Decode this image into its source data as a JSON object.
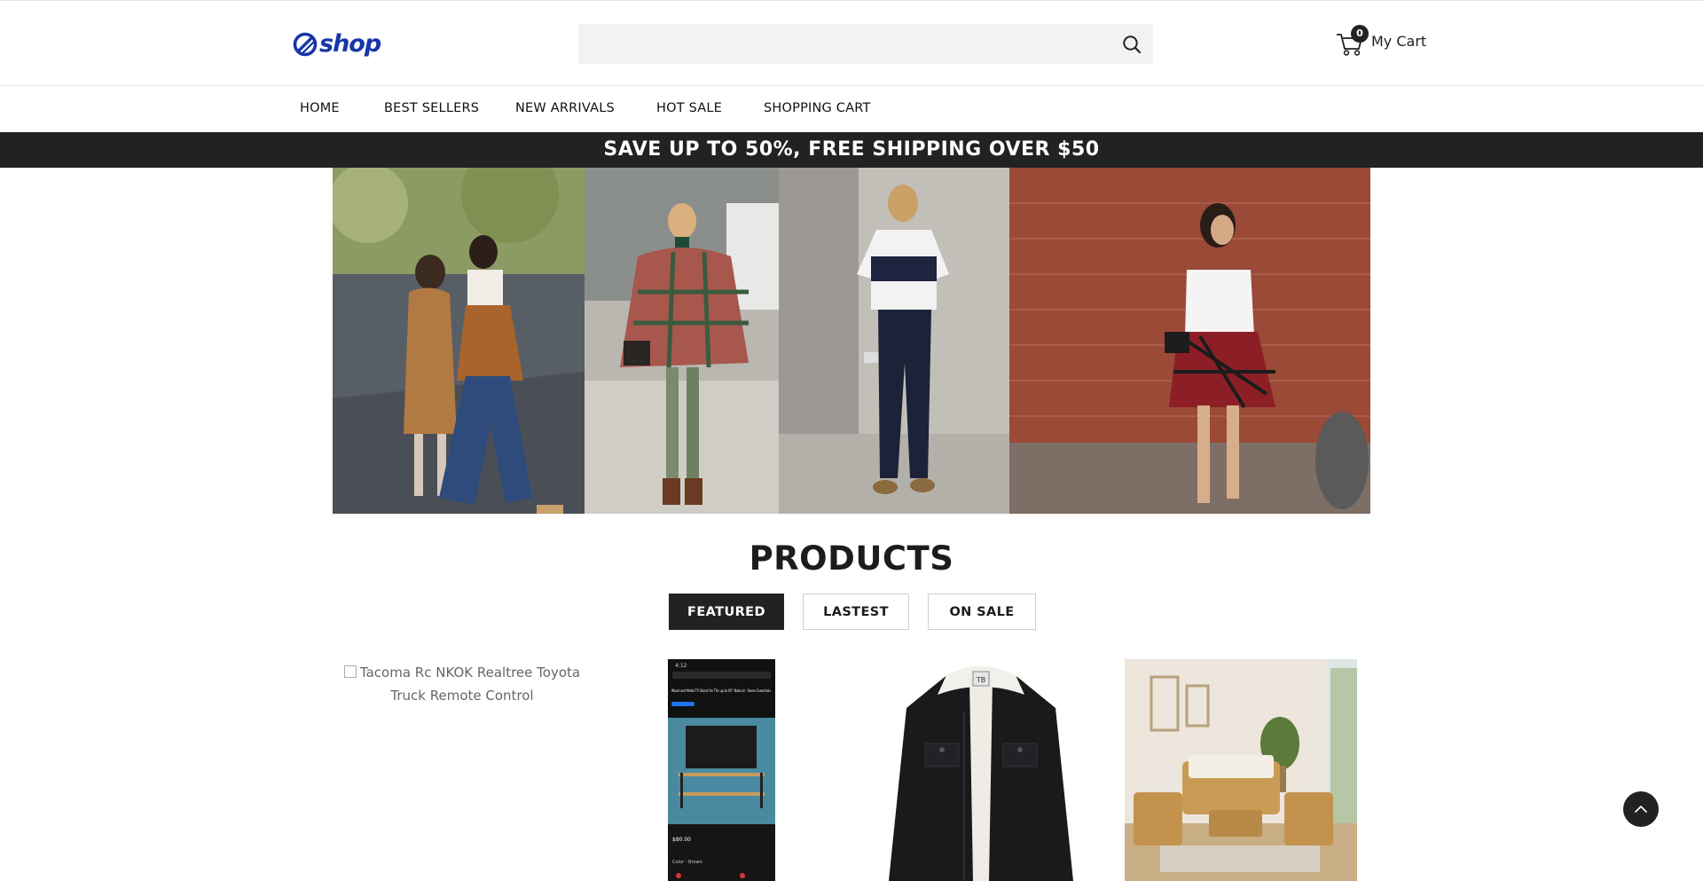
{
  "header": {
    "logo_text": "shop",
    "search": {
      "value": "",
      "placeholder": ""
    },
    "cart": {
      "count": "0",
      "label": "My Cart"
    }
  },
  "nav": {
    "items": [
      {
        "label": "HOME"
      },
      {
        "label": "BEST SELLERS"
      },
      {
        "label": "NEW ARRIVALS"
      },
      {
        "label": "HOT SALE"
      },
      {
        "label": "SHOPPING CART"
      }
    ]
  },
  "promo": {
    "text": "SAVE UP TO 50%, FREE SHIPPING OVER $50"
  },
  "products": {
    "title": "PRODUCTS",
    "tabs": [
      {
        "label": "FEATURED",
        "active": true
      },
      {
        "label": "LASTEST",
        "active": false
      },
      {
        "label": "ON SALE",
        "active": false
      }
    ],
    "items": [
      {
        "alt": "Tacoma Rc NKOK Realtree Toyota Truck Remote Control",
        "image_loaded": false
      },
      {
        "alt": "",
        "image_loaded": true
      },
      {
        "alt": "",
        "image_loaded": true
      },
      {
        "alt": "",
        "image_loaded": true
      }
    ]
  },
  "phone_screenshot": {
    "status_time": "4:12",
    "headline": "Wood and Metal TV Stand for TVs up to 65\" Natural - Room Essentials",
    "price": "$80.00",
    "color_label": "Color - Brown"
  },
  "jacket_tag": "TB",
  "colors": {
    "brand_blue": "#1636a8",
    "dark": "#222222",
    "search_bg": "#f2f2f2"
  }
}
